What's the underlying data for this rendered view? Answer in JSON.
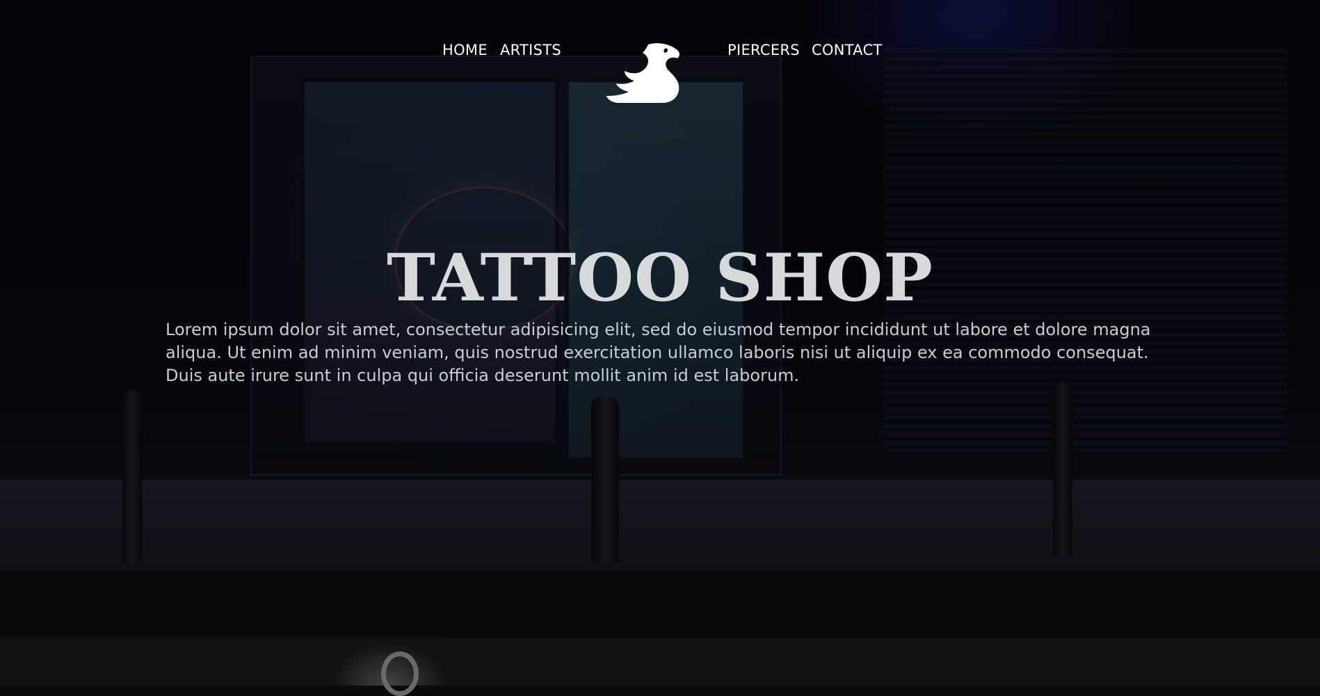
{
  "nav": {
    "home_label": "HOME",
    "artists_label": "ARTISTS",
    "piercers_label": "PIERCERS",
    "contact_label": "CONTACT",
    "logo_icon": "dragon-logo-icon"
  },
  "hero": {
    "title": "TATTOO SHOP",
    "description": "Lorem ipsum dolor sit amet, consectetur adipisicing elit, sed do eiusmod tempor incididunt ut labore et dolore magna aliqua. Ut enim ad minim veniam, quis nostrud exercitation ullamco laboris nisi ut aliquip ex ea commodo consequat. Duis aute irure sunt in culpa qui officia deserunt mollit anim id est laborum."
  },
  "colors": {
    "nav_text": "#ffffff",
    "title_text": "#d7dadb",
    "body_text": "#c9cdd3",
    "bottom_panel": "#121212"
  }
}
